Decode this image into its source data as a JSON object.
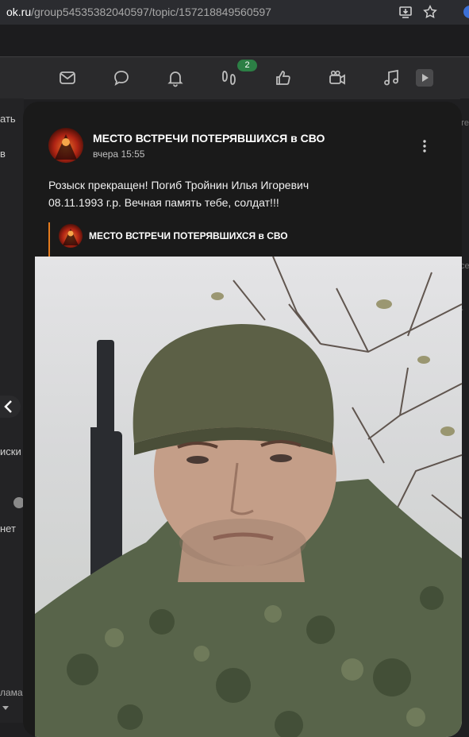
{
  "browser": {
    "url_host": "ok.ru",
    "url_path": "/group54535382040597/topic/157218849560597"
  },
  "nav": {
    "icons": [
      "mail-icon",
      "chat-icon",
      "bell-icon",
      "guests-icon",
      "like-icon",
      "video-icon",
      "music-icon",
      "play-icon"
    ],
    "badge": "2"
  },
  "sidebar_left": {
    "items": [
      "ать",
      "в",
      "иски",
      "нет",
      "лама"
    ]
  },
  "sidebar_right": {
    "items": [
      "те",
      "се",
      "-"
    ]
  },
  "post": {
    "group_name": "МЕСТО ВСТРЕЧИ ПОТЕРЯВШИХСЯ в СВО",
    "time": "вчера 15:55",
    "text_line1": "Розыск прекращен! Погиб Тройнин Илья Игоревич",
    "text_line2": "08.11.1993 г.р. Вечная память тебе, солдат!!!",
    "repost_group_name": "МЕСТО ВСТРЕЧИ ПОТЕРЯВШИХСЯ в СВО"
  },
  "colors": {
    "accent_orange": "#e47b1e",
    "badge_green": "#2c7f45",
    "modal_bg": "#1a1a1a"
  }
}
